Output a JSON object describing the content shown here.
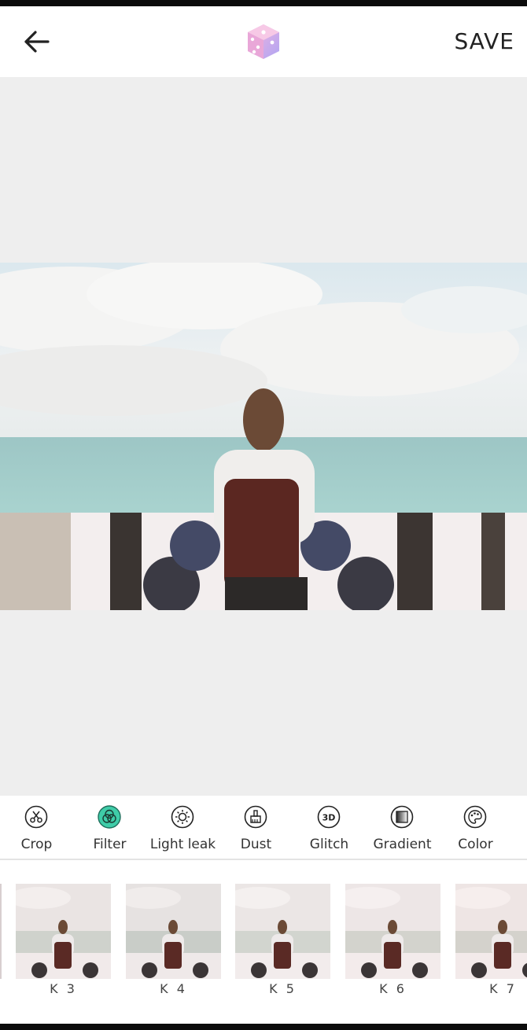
{
  "header": {
    "save_label": "SAVE"
  },
  "tools": [
    {
      "label": "Crop",
      "icon": "scissors-icon",
      "active": false
    },
    {
      "label": "Filter",
      "icon": "filter-icon",
      "active": true
    },
    {
      "label": "Light leak",
      "icon": "sun-icon",
      "active": false
    },
    {
      "label": "Dust",
      "icon": "brush-icon",
      "active": false
    },
    {
      "label": "Glitch",
      "icon": "3d-icon",
      "active": false
    },
    {
      "label": "Gradient",
      "icon": "gradient-icon",
      "active": false
    },
    {
      "label": "Color",
      "icon": "palette-icon",
      "active": false
    }
  ],
  "glitch_icon_text": "3D",
  "filters": [
    {
      "label": "K 3"
    },
    {
      "label": "K 4"
    },
    {
      "label": "K 5"
    },
    {
      "label": "K 6"
    },
    {
      "label": "K 7"
    }
  ],
  "colors": {
    "accent": "#3fcca8",
    "canvas_bg": "#eeeeee",
    "logo_gradient_start": "#f2a6d6",
    "logo_gradient_end": "#b7a8f5"
  }
}
